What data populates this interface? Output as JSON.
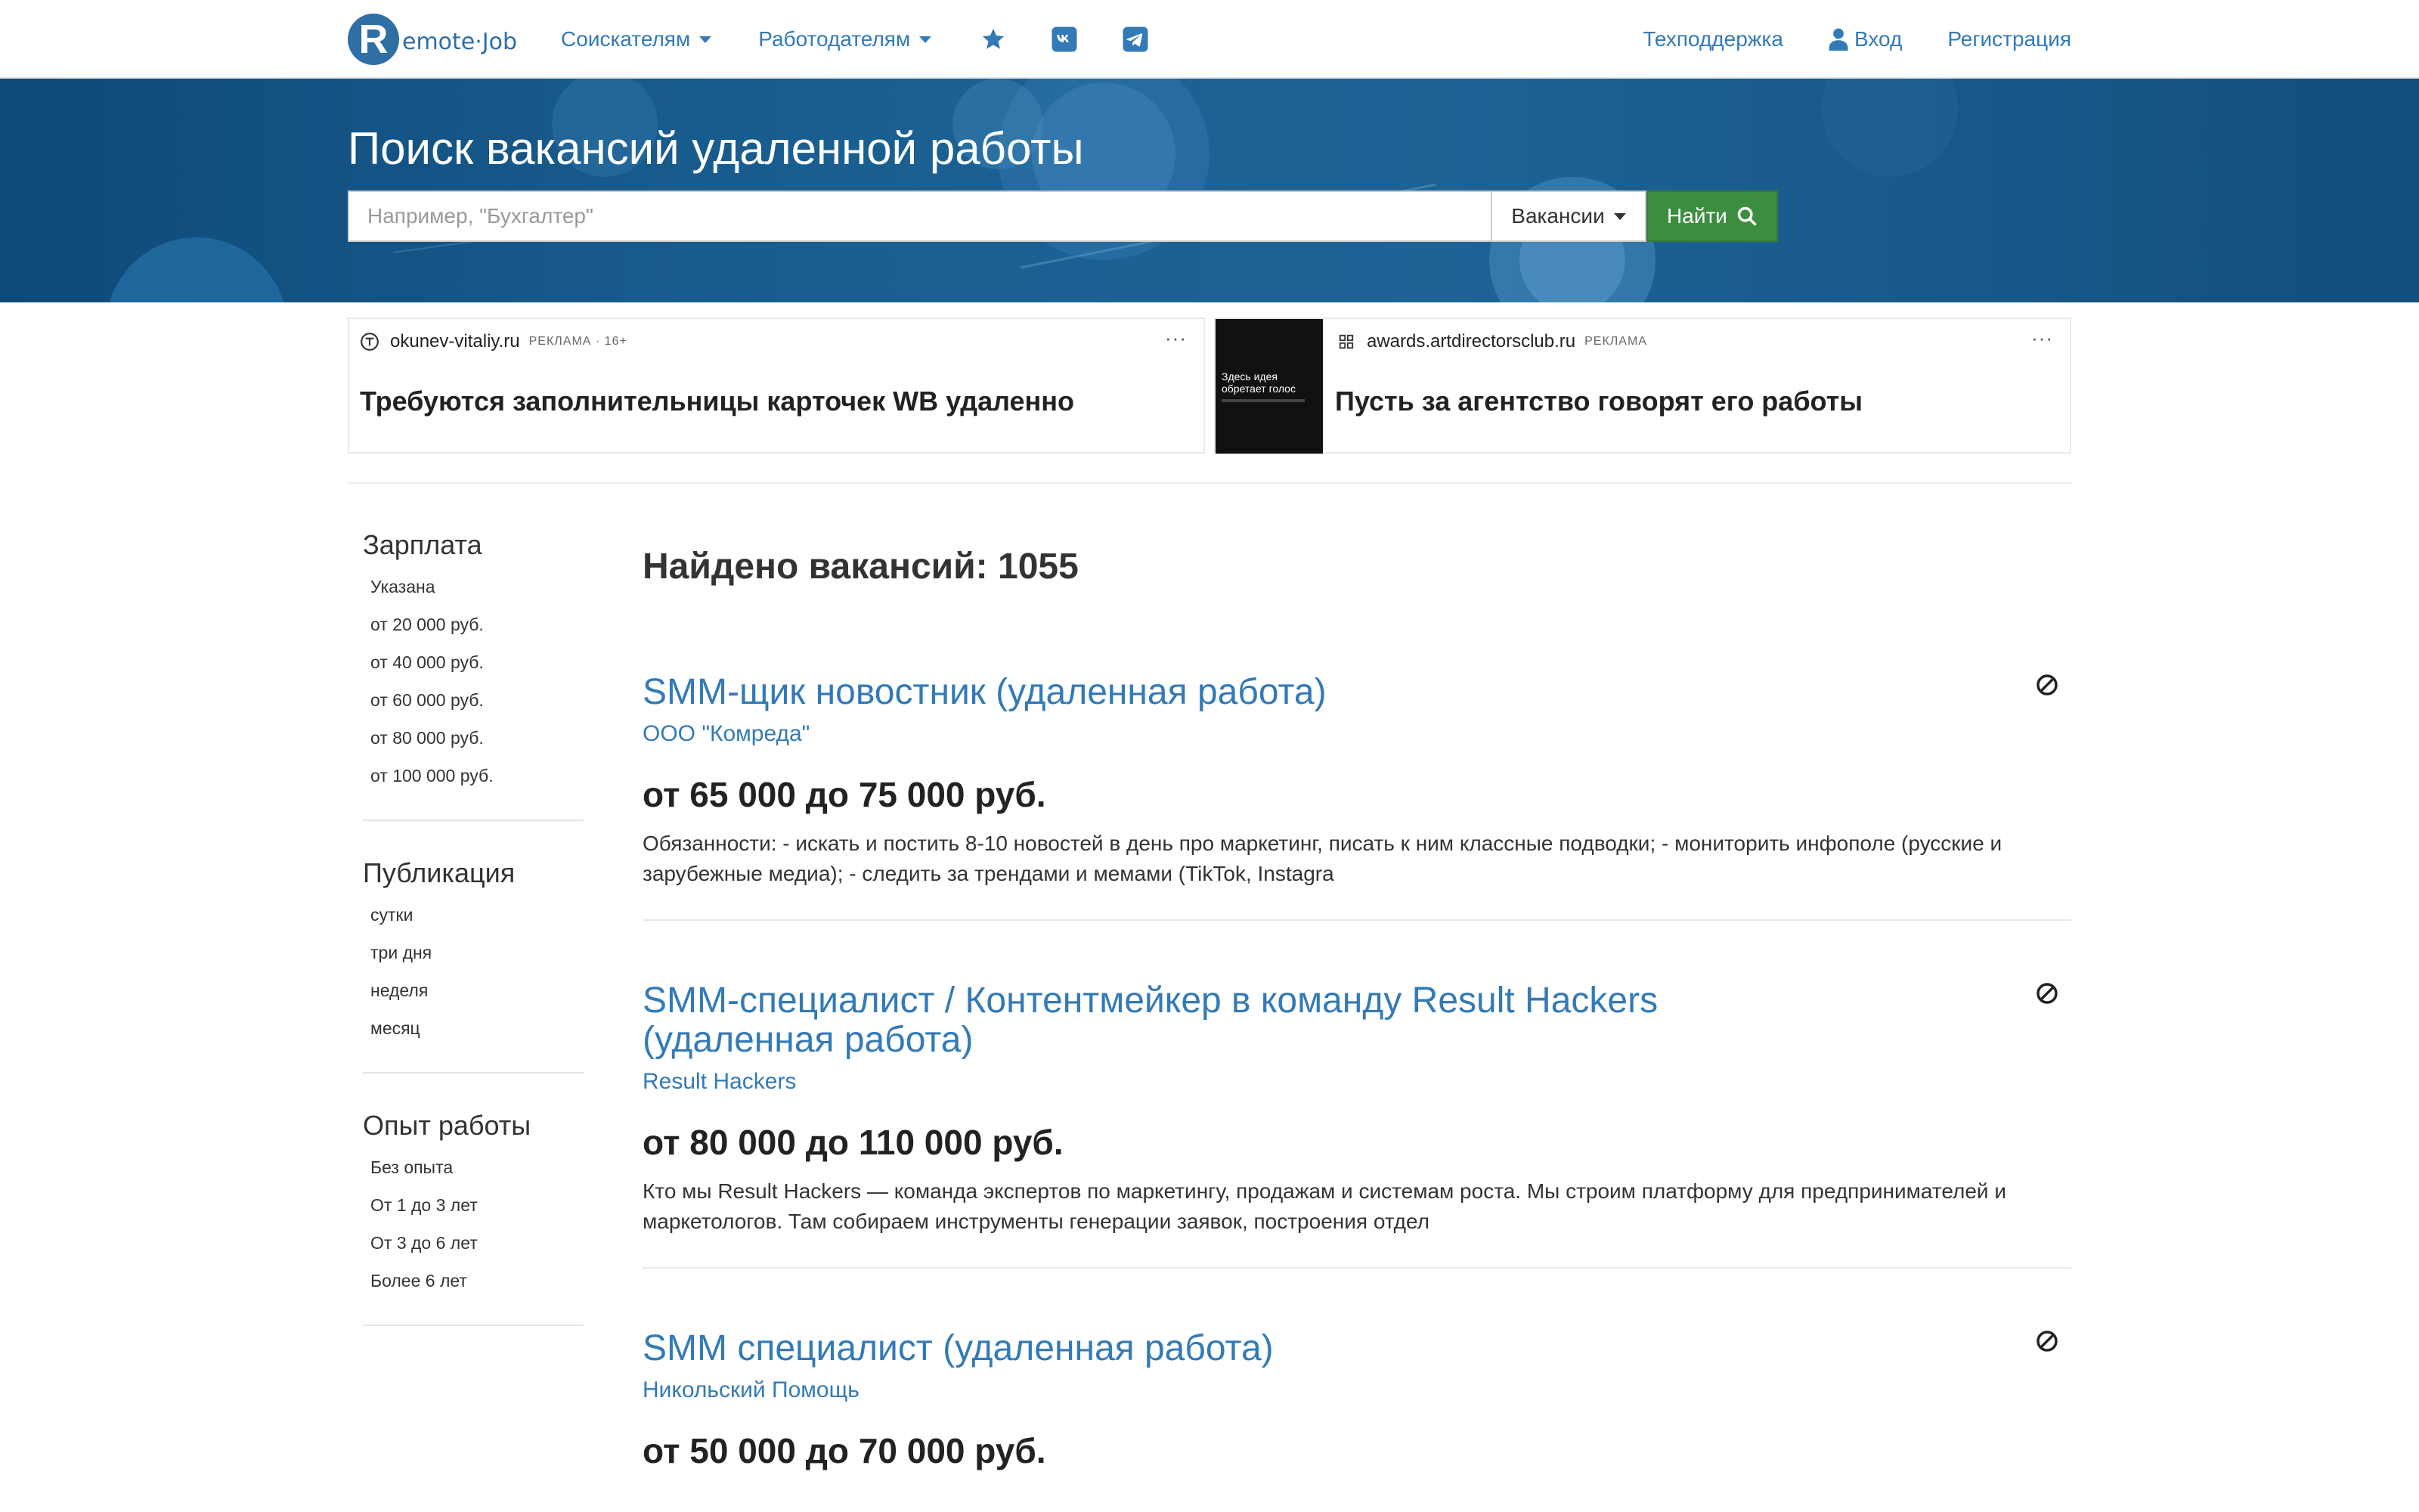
{
  "nav": {
    "logo_letter": "R",
    "logo_text": "emote·Job",
    "seekers": "Соискателям",
    "employers": "Работодателям",
    "support": "Техподдержка",
    "login": "Вход",
    "register": "Регистрация"
  },
  "hero": {
    "title": "Поиск вакансий удаленной работы",
    "search_placeholder": "Например, \"Бухгалтер\"",
    "search_type": "Вакансии",
    "search_button": "Найти"
  },
  "ads": [
    {
      "source": "okunev-vitaliy.ru",
      "label": "РЕКЛАМА · 16+",
      "title": "Требуются заполнительницы карточек WB удаленно"
    },
    {
      "source": "awards.artdirectorsclub.ru",
      "label": "РЕКЛАМА",
      "title": "Пусть за агентство говорят его работы",
      "thumb_text": "Здесь идея обретает голос"
    }
  ],
  "filters": [
    {
      "title": "Зарплата",
      "items": [
        "Указана",
        "от 20 000 руб.",
        "от 40 000 руб.",
        "от 60 000 руб.",
        "от 80 000 руб.",
        "от 100 000 руб."
      ]
    },
    {
      "title": "Публикация",
      "items": [
        "сутки",
        "три дня",
        "неделя",
        "месяц"
      ]
    },
    {
      "title": "Опыт работы",
      "items": [
        "Без опыта",
        "От 1 до 3 лет",
        "От 3 до 6 лет",
        "Более 6 лет"
      ]
    }
  ],
  "results": {
    "found": "Найдено вакансий: 1055"
  },
  "vacancies": [
    {
      "title": "SMM-щик новостник (удаленная работа)",
      "company": "ООО \"Комреда\"",
      "salary": "от 65 000 до 75 000 руб.",
      "description": "Обязанности: - искать и постить 8-10 новостей в день про маркетинг, писать к ним классные подводки; - мониторить инфополе (русские и зарубежные медиа); - следить за трендами и мемами (TikTok, Instagra"
    },
    {
      "title": "SMM-специалист / Контентмейкер в команду Result Hackers (удаленная работа)",
      "company": "Result Hackers",
      "salary": "от 80 000 до 110 000 руб.",
      "description": "Кто мы Result Hackers — команда экспертов по маркетингу, продажам и системам роста. Мы строим платформу для предпринимателей и маркетологов. Там собираем инструменты генерации заявок, построения отдел"
    },
    {
      "title": "SMM специалист (удаленная работа)",
      "company": "Никольский Помощь",
      "salary": "от 50 000 до 70 000 руб.",
      "description": ""
    }
  ],
  "colors": {
    "link": "#337ab7",
    "hero_bg": "#1a5f92",
    "search_button": "#3c8d3f"
  },
  "icons": {
    "favorites": "star-icon",
    "vk": "vk-icon",
    "telegram": "telegram-icon",
    "user": "user-icon",
    "search": "search-icon",
    "hide": "hide-vacancy-icon"
  }
}
